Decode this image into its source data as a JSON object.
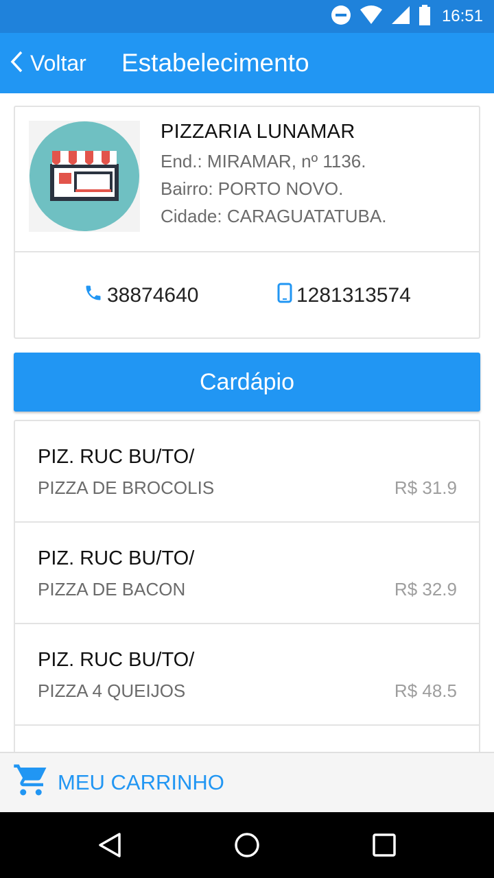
{
  "status_bar": {
    "time": "16:51",
    "icons": [
      "do-not-disturb-icon",
      "wifi-icon",
      "signal-icon",
      "battery-icon"
    ]
  },
  "app_bar": {
    "back_label": "Voltar",
    "title": "Estabelecimento"
  },
  "store": {
    "name": "PIZZARIA LUNAMAR",
    "address": "End.: MIRAMAR, nº 1136.",
    "neighborhood": "Bairro: PORTO NOVO.",
    "city": "Cidade: CARAGUATATUBA.",
    "phone": "38874640",
    "mobile": "1281313574",
    "logo_icon": "storefront-icon"
  },
  "menu_button_label": "Cardápio",
  "menu_items": [
    {
      "code": "PIZ. RUC BU/TO/",
      "name": "PIZZA DE BROCOLIS",
      "price": "R$ 31.9"
    },
    {
      "code": "PIZ. RUC BU/TO/",
      "name": "PIZZA DE BACON",
      "price": "R$ 32.9"
    },
    {
      "code": "PIZ. RUC BU/TO/",
      "name": "PIZZA 4 QUEIJOS",
      "price": "R$ 48.5"
    }
  ],
  "cart": {
    "label": "MEU CARRINHO",
    "icon": "cart-icon"
  },
  "colors": {
    "primary": "#2196f3",
    "status_bar": "#1f82db",
    "logo_circle": "#6fc0c2",
    "awning_red": "#e2544b"
  }
}
